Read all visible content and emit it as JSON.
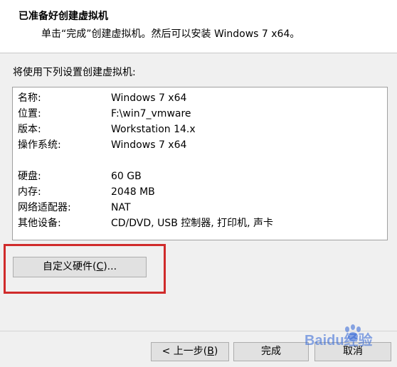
{
  "header": {
    "title": "已准备好创建虚拟机",
    "subtitle": "单击“完成”创建虚拟机。然后可以安装 Windows 7 x64。"
  },
  "intro": "将使用下列设置创建虚拟机:",
  "settings": [
    {
      "key": "名称:",
      "value": "Windows 7 x64"
    },
    {
      "key": "位置:",
      "value": "F:\\win7_vmware"
    },
    {
      "key": "版本:",
      "value": "Workstation 14.x"
    },
    {
      "key": "操作系统:",
      "value": "Windows 7 x64"
    },
    {
      "key": "硬盘:",
      "value": "60 GB"
    },
    {
      "key": "内存:",
      "value": "2048 MB"
    },
    {
      "key": "网络适配器:",
      "value": "NAT"
    },
    {
      "key": "其他设备:",
      "value": "CD/DVD, USB 控制器, 打印机, 声卡"
    }
  ],
  "buttons": {
    "customize": {
      "pre": "自定义硬件(",
      "mnemonic": "C",
      "post": ")..."
    },
    "back": {
      "pre": "< 上一步(",
      "mnemonic": "B",
      "post": ")"
    },
    "finish": "完成",
    "cancel": "取消"
  },
  "colors": {
    "highlight": "#d02b2b",
    "watermark": "#2f64d6"
  },
  "watermark": {
    "text": "Baidu经验",
    "icon": "baidu-paw-icon"
  }
}
